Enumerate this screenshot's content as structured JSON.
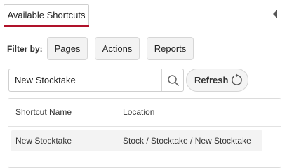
{
  "tabs": {
    "active_label": "Available Shortcuts",
    "accent_color": "#b0122a"
  },
  "filter": {
    "label": "Filter by:",
    "buttons": [
      "Pages",
      "Actions",
      "Reports"
    ]
  },
  "search": {
    "value": "New Stocktake",
    "icon": "search-icon"
  },
  "refresh": {
    "label": "Refresh",
    "icon": "refresh-icon"
  },
  "table": {
    "columns": [
      "Shortcut Name",
      "Location"
    ],
    "rows": [
      {
        "name": "New Stocktake",
        "location": "Stock / Stocktake / New Stocktake"
      }
    ]
  }
}
